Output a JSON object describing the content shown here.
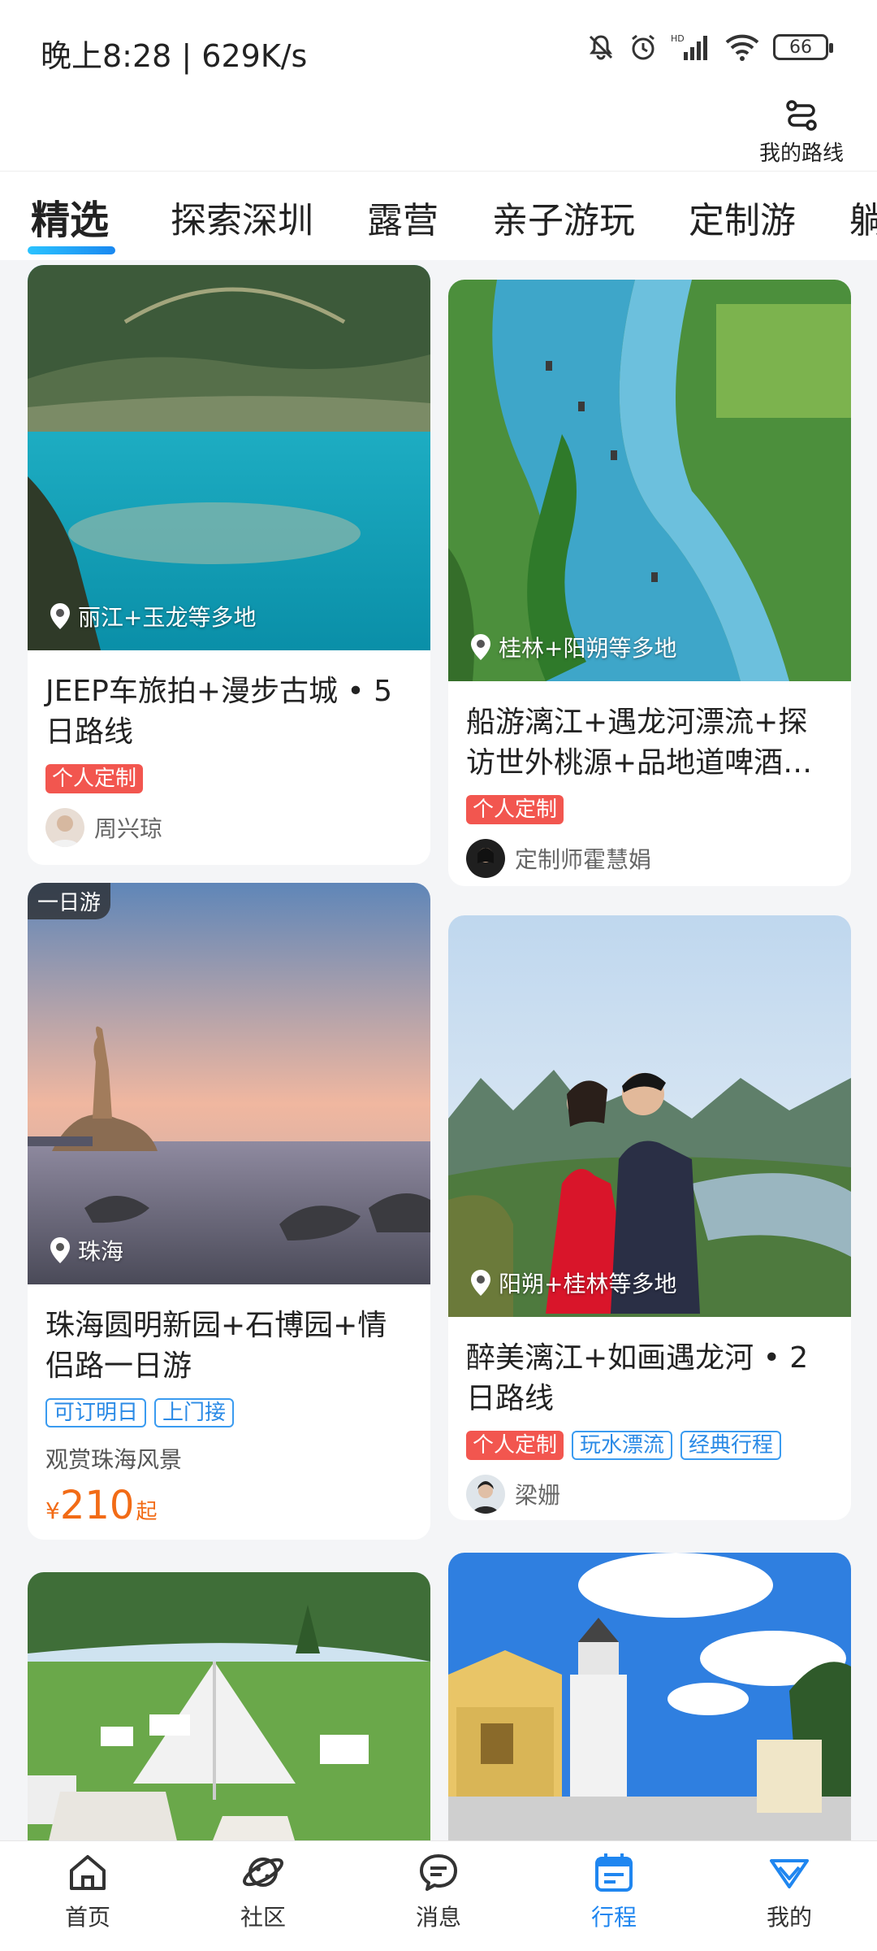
{
  "status_bar": {
    "time": "晚上8:28 | 629K/s",
    "battery": "66"
  },
  "header": {
    "route_label": "我的路线"
  },
  "tabs": [
    {
      "label": "精选",
      "active": true
    },
    {
      "label": "探索深圳"
    },
    {
      "label": "露营"
    },
    {
      "label": "亲子游玩"
    },
    {
      "label": "定制游"
    },
    {
      "label": "躺"
    }
  ],
  "cards": [
    {
      "location": "丽江+玉龙等多地",
      "title": "JEEP车旅拍+漫步古城 • 5日路线",
      "tags": [
        "个人定制"
      ],
      "author": "周兴琼"
    },
    {
      "location": "桂林+阳朔等多地",
      "title": "船游漓江+遇龙河漂流+探访世外桃源+品地道啤酒…",
      "tags": [
        "个人定制"
      ],
      "author": "定制师霍慧娟"
    },
    {
      "badge": "一日游",
      "location": "珠海",
      "title": "珠海圆明新园+石博园+情侣路一日游",
      "tags": [
        "可订明日",
        "上门接"
      ],
      "subtitle": "观赏珠海风景",
      "price_currency": "¥",
      "price": "210",
      "price_unit": "起"
    },
    {
      "location": "阳朔+桂林等多地",
      "title": "醉美漓江+如画遇龙河 • 2日路线",
      "tags": [
        "个人定制",
        "玩水漂流",
        "经典行程"
      ],
      "author": "梁姗"
    }
  ],
  "bottom_nav": [
    {
      "label": "首页",
      "icon": "home-icon"
    },
    {
      "label": "社区",
      "icon": "planet-icon"
    },
    {
      "label": "消息",
      "icon": "message-icon"
    },
    {
      "label": "行程",
      "icon": "calendar-icon",
      "active": true
    },
    {
      "label": "我的",
      "icon": "profile-icon"
    }
  ],
  "colors": {
    "accent": "#1f86f0",
    "tag_red": "#f2564f",
    "price": "#f26b16"
  }
}
